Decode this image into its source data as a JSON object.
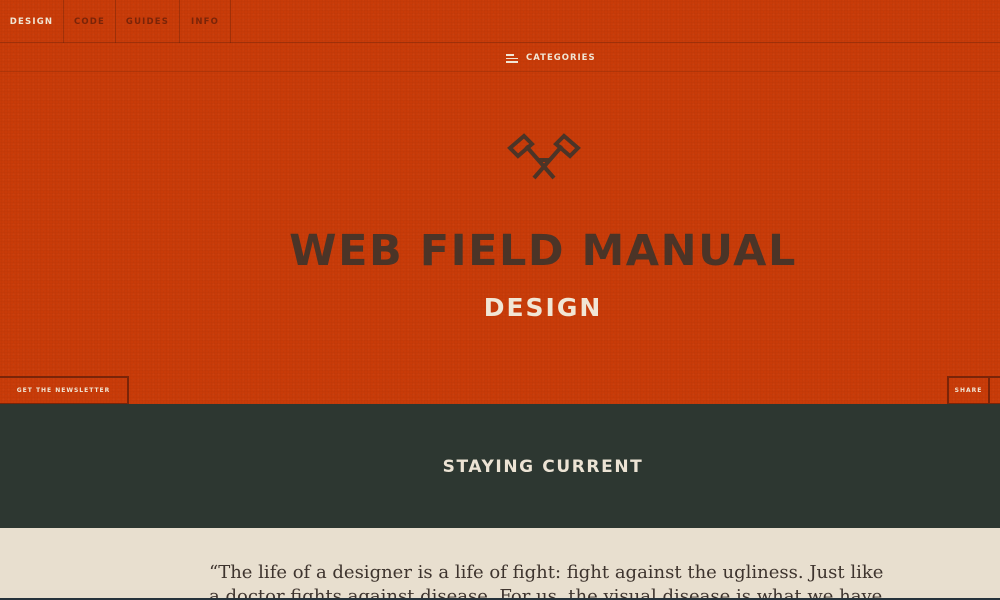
{
  "nav": {
    "tabs": [
      {
        "label": "DESIGN"
      },
      {
        "label": "CODE"
      },
      {
        "label": "GUIDES"
      },
      {
        "label": "INFO"
      }
    ],
    "active_tab": "DESIGN",
    "categories_label": "CATEGORIES"
  },
  "hero": {
    "logo_icon": "crossed-axes-icon",
    "site_title": "WEB FIELD MANUAL",
    "section_title": "DESIGN",
    "newsletter_label": "GET THE NEWSLETTER",
    "share_label": "SHARE"
  },
  "section": {
    "heading": "STAYING CURRENT"
  },
  "quote": {
    "text": "“The life of a designer is a life of fight: fight against the ugliness. Just like a doctor fights against disease. For us, the visual disease is what we have"
  },
  "colors": {
    "hero_bg": "#c83b08",
    "title_brown": "#4b3427",
    "cream": "#f1e6d5",
    "band_bg": "#2d3731",
    "paper_bg": "#e8dfcf"
  }
}
